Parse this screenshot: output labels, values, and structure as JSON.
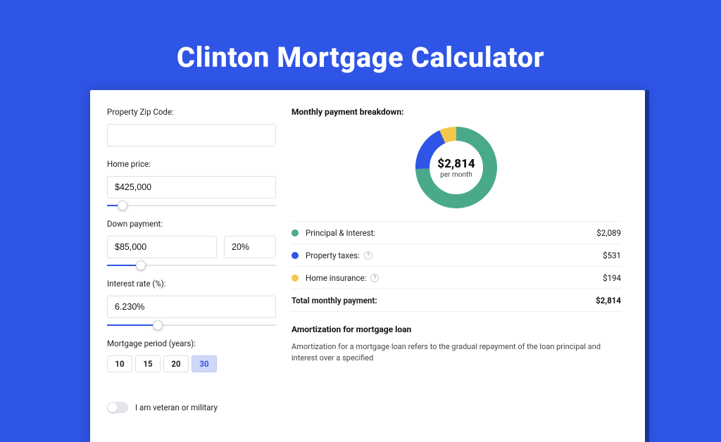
{
  "hero": {
    "title": "Clinton Mortgage Calculator"
  },
  "form": {
    "zip": {
      "label": "Property Zip Code:"
    },
    "price": {
      "label": "Home price:",
      "value": "$425,000",
      "slider_pct": 9
    },
    "down": {
      "label": "Down payment:",
      "value": "$85,000",
      "pct": "20%",
      "slider_pct": 20
    },
    "rate": {
      "label": "Interest rate (%):",
      "value": "6.230%",
      "slider_pct": 30
    },
    "period": {
      "label": "Mortgage period (years):",
      "options": [
        "10",
        "15",
        "20",
        "30"
      ],
      "active_index": 3
    },
    "veteran": {
      "label": "I am veteran or military",
      "on": false
    }
  },
  "breakdown": {
    "title": "Monthly payment breakdown:",
    "center_amount": "$2,814",
    "center_sub": "per month",
    "items": [
      {
        "color": "#4aa98b",
        "label": "Principal & Interest:",
        "value": "$2,089",
        "info": false
      },
      {
        "color": "#2f55e6",
        "label": "Property taxes:",
        "value": "$531",
        "info": true
      },
      {
        "color": "#f1c84b",
        "label": "Home insurance:",
        "value": "$194",
        "info": true
      }
    ],
    "total_label": "Total monthly payment:",
    "total_value": "$2,814"
  },
  "amort": {
    "title": "Amortization for mortgage loan",
    "text": "Amortization for a mortgage loan refers to the gradual repayment of the loan principal and interest over a specified"
  },
  "chart_data": {
    "type": "pie",
    "title": "Monthly payment breakdown",
    "categories": [
      "Principal & Interest",
      "Property taxes",
      "Home insurance"
    ],
    "values": [
      2089,
      531,
      194
    ],
    "colors": [
      "#4aa98b",
      "#2f55e6",
      "#f1c84b"
    ],
    "total": 2814,
    "center_label": "$2,814 per month"
  }
}
